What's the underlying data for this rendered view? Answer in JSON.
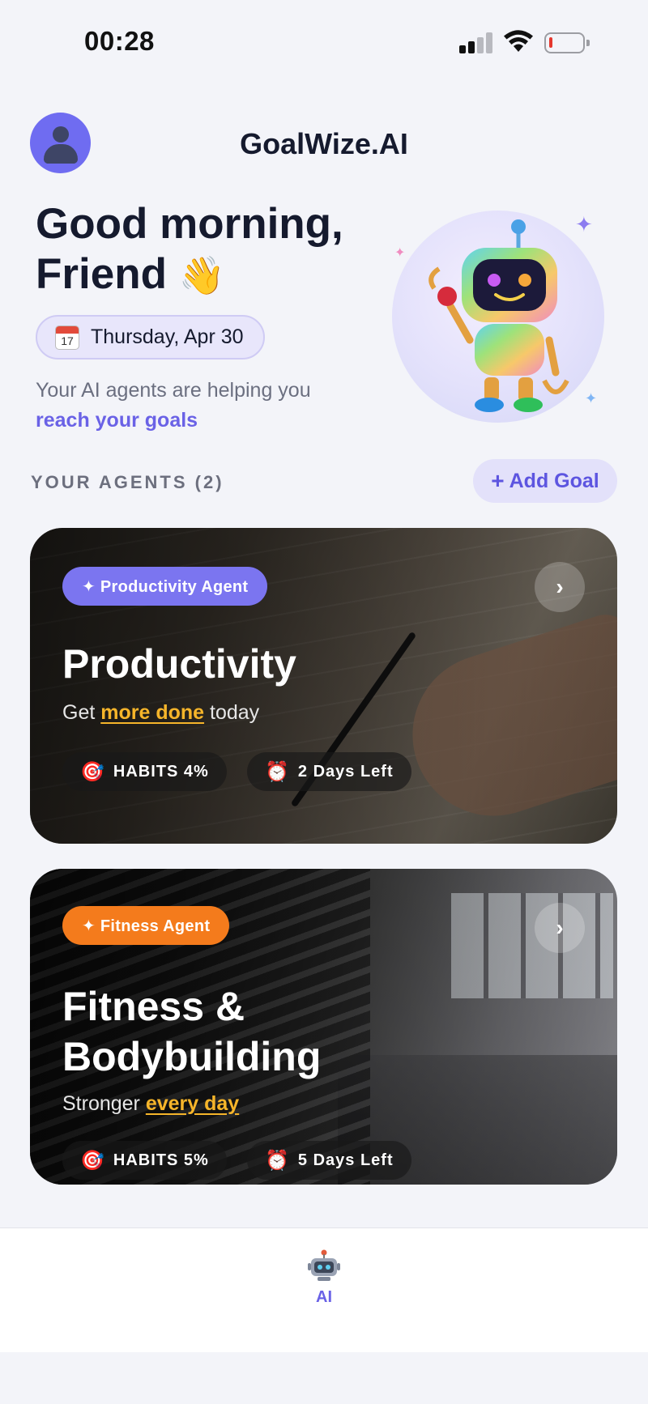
{
  "status_bar": {
    "time": "00:28",
    "signal_icon": "cellular-signal-icon",
    "wifi_icon": "wifi-icon",
    "battery_icon": "battery-low-icon",
    "battery_color": "#e5372e"
  },
  "header": {
    "avatar_icon": "user-avatar-icon",
    "app_title": "GoalWize.AI"
  },
  "greeting": {
    "line1": "Good morning,",
    "line2": "Friend",
    "emoji": "👋",
    "date_icon": "calendar-icon",
    "calendar_day": "17",
    "date": "Thursday, Apr 30",
    "subtitle": "Your AI agents are helping you",
    "subtitle_highlight": "reach your goals",
    "mascot": "robot-mascot-illustration"
  },
  "agents": {
    "section_label": "YOUR AGENTS (2)",
    "add_goal_icon": "+",
    "add_goal_label": "Add Goal",
    "accent_color": "#6a62e6",
    "cards": [
      {
        "badge": "✦ Productivity Agent",
        "badge_color": "#7b75f0",
        "title_line1": "Productivity",
        "title_line2": "",
        "subtitle_prefix": "Get",
        "subtitle_highlight": "more done",
        "subtitle_suffix": "today",
        "habits_icon": "🎯",
        "habits": "HABITS 4%",
        "habits_progress": 4,
        "days_icon": "⏰",
        "days_left": "2 Days Left",
        "chevron": "›",
        "image": "notebook-writing-photo"
      },
      {
        "badge": "✦ Fitness Agent",
        "badge_color": "#f47b1c",
        "title_line1": "Fitness &",
        "title_line2": "Bodybuilding",
        "subtitle_prefix": "Stronger",
        "subtitle_highlight": "every day",
        "subtitle_suffix": "",
        "habits_icon": "🎯",
        "habits": "HABITS 5%",
        "habits_progress": 5,
        "days_icon": "⏰",
        "days_left": "5 Days Left",
        "chevron": "›",
        "image": "gym-dumbbells-photo"
      }
    ]
  },
  "tab_bar": {
    "tabs": [
      {
        "icon": "robot-icon",
        "label": "AI",
        "active": true
      }
    ]
  }
}
